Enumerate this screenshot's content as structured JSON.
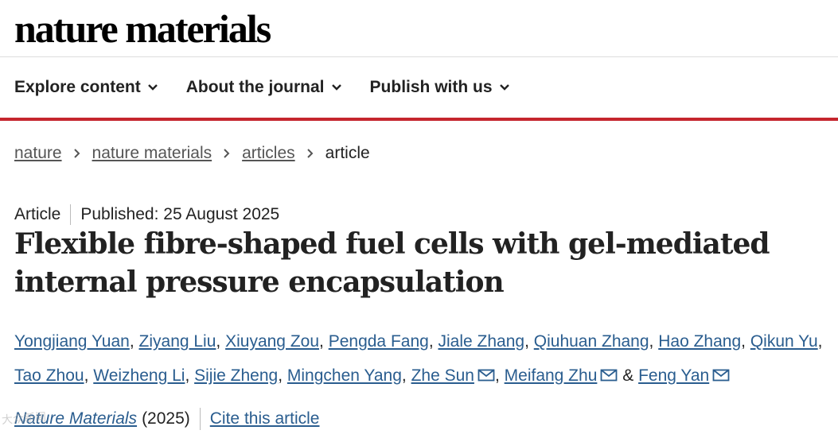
{
  "header": {
    "logo": "nature materials"
  },
  "nav": {
    "items": [
      {
        "label": "Explore content"
      },
      {
        "label": "About the journal"
      },
      {
        "label": "Publish with us"
      }
    ]
  },
  "breadcrumb": {
    "items": [
      "nature",
      "nature materials",
      "articles"
    ],
    "current": "article"
  },
  "article": {
    "type": "Article",
    "published": "Published: 25 August 2025",
    "title": "Flexible fibre-shaped fuel cells with gel-mediated internal pressure encapsulation",
    "authors": [
      "Yongjiang Yuan",
      "Ziyang Liu",
      "Xiuyang Zou",
      "Pengda Fang",
      "Jiale Zhang",
      "Qiuhuan Zhang",
      "Hao Zhang",
      "Qikun Yu",
      "Tao Zhou",
      "Weizheng Li",
      "Sijie Zheng",
      "Mingchen Yang",
      "Zhe Sun",
      "Meifang Zhu",
      "Feng Yan"
    ],
    "separator": ",",
    "and": "&",
    "journal": "Nature Materials",
    "year": "(2025)",
    "cite": "Cite this article"
  },
  "watermark": {
    "text": "大众新闻"
  },
  "colors": {
    "accent_red": "#c5262e",
    "link_blue": "#2a5d8f",
    "text": "#222222"
  }
}
